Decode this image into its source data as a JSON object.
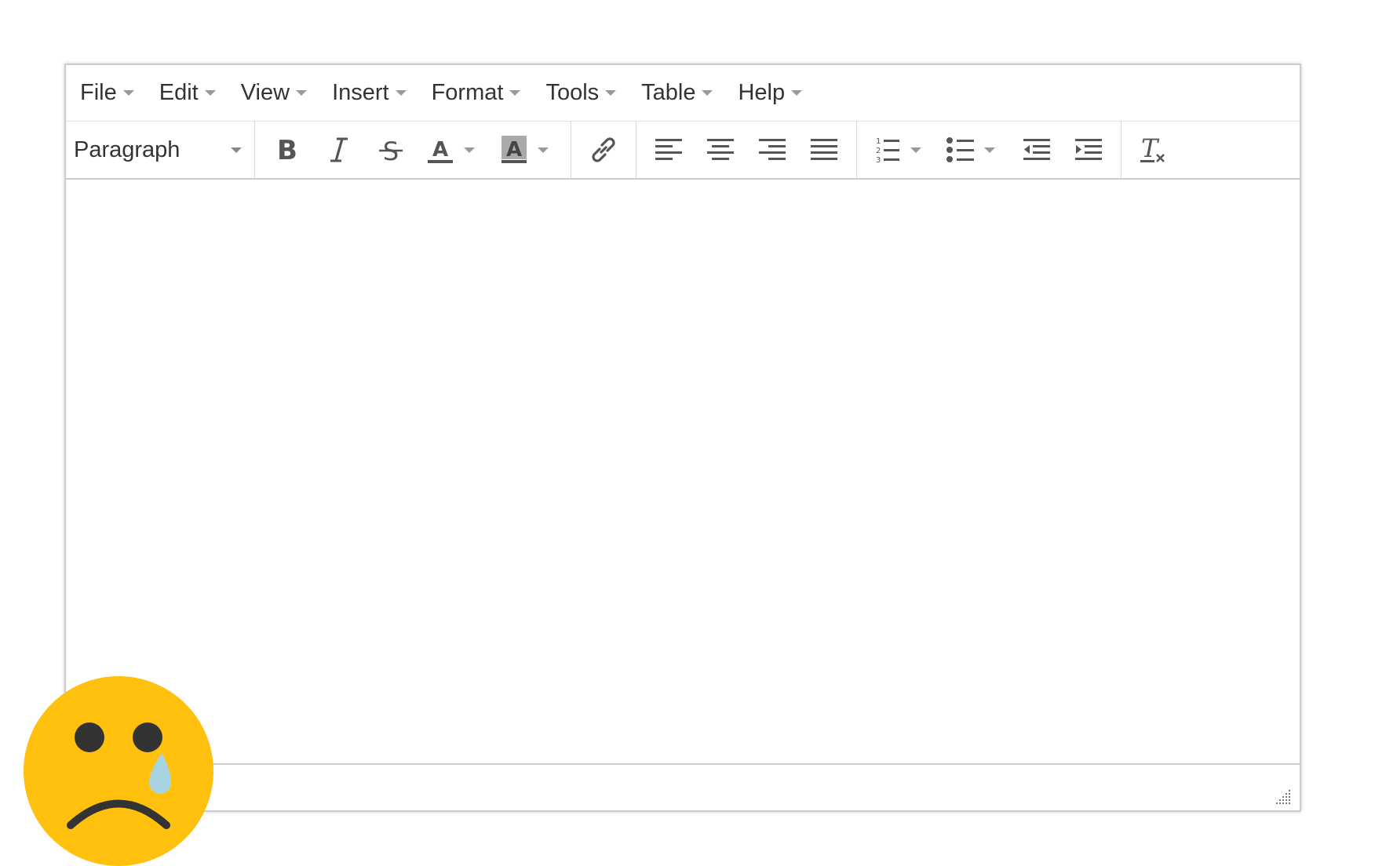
{
  "menubar": {
    "items": [
      {
        "label": "File"
      },
      {
        "label": "Edit"
      },
      {
        "label": "View"
      },
      {
        "label": "Insert"
      },
      {
        "label": "Format"
      },
      {
        "label": "Tools"
      },
      {
        "label": "Table"
      },
      {
        "label": "Help"
      }
    ]
  },
  "toolbar": {
    "block_format": "Paragraph",
    "icons": [
      "bold-icon",
      "italic-icon",
      "strikethrough-icon",
      "text-color-icon",
      "background-color-icon",
      "link-icon",
      "align-left-icon",
      "align-center-icon",
      "align-right-icon",
      "align-justify-icon",
      "numbered-list-icon",
      "bullet-list-icon",
      "outdent-icon",
      "indent-icon",
      "clear-formatting-icon"
    ],
    "text_color_letter": "A",
    "bg_color_letter": "A",
    "bold_letter": "B",
    "italic_letter": "I",
    "strike_letter": "S",
    "clear_letter": "T"
  },
  "colors": {
    "accent_text_color": "#555555",
    "background_highlight": "#aaaaaa",
    "emoji_face": "#FFC10E",
    "emoji_tear": "#A8D4E2",
    "emoji_features": "#333333"
  },
  "overlay": {
    "emoji": "crying-face-icon"
  }
}
